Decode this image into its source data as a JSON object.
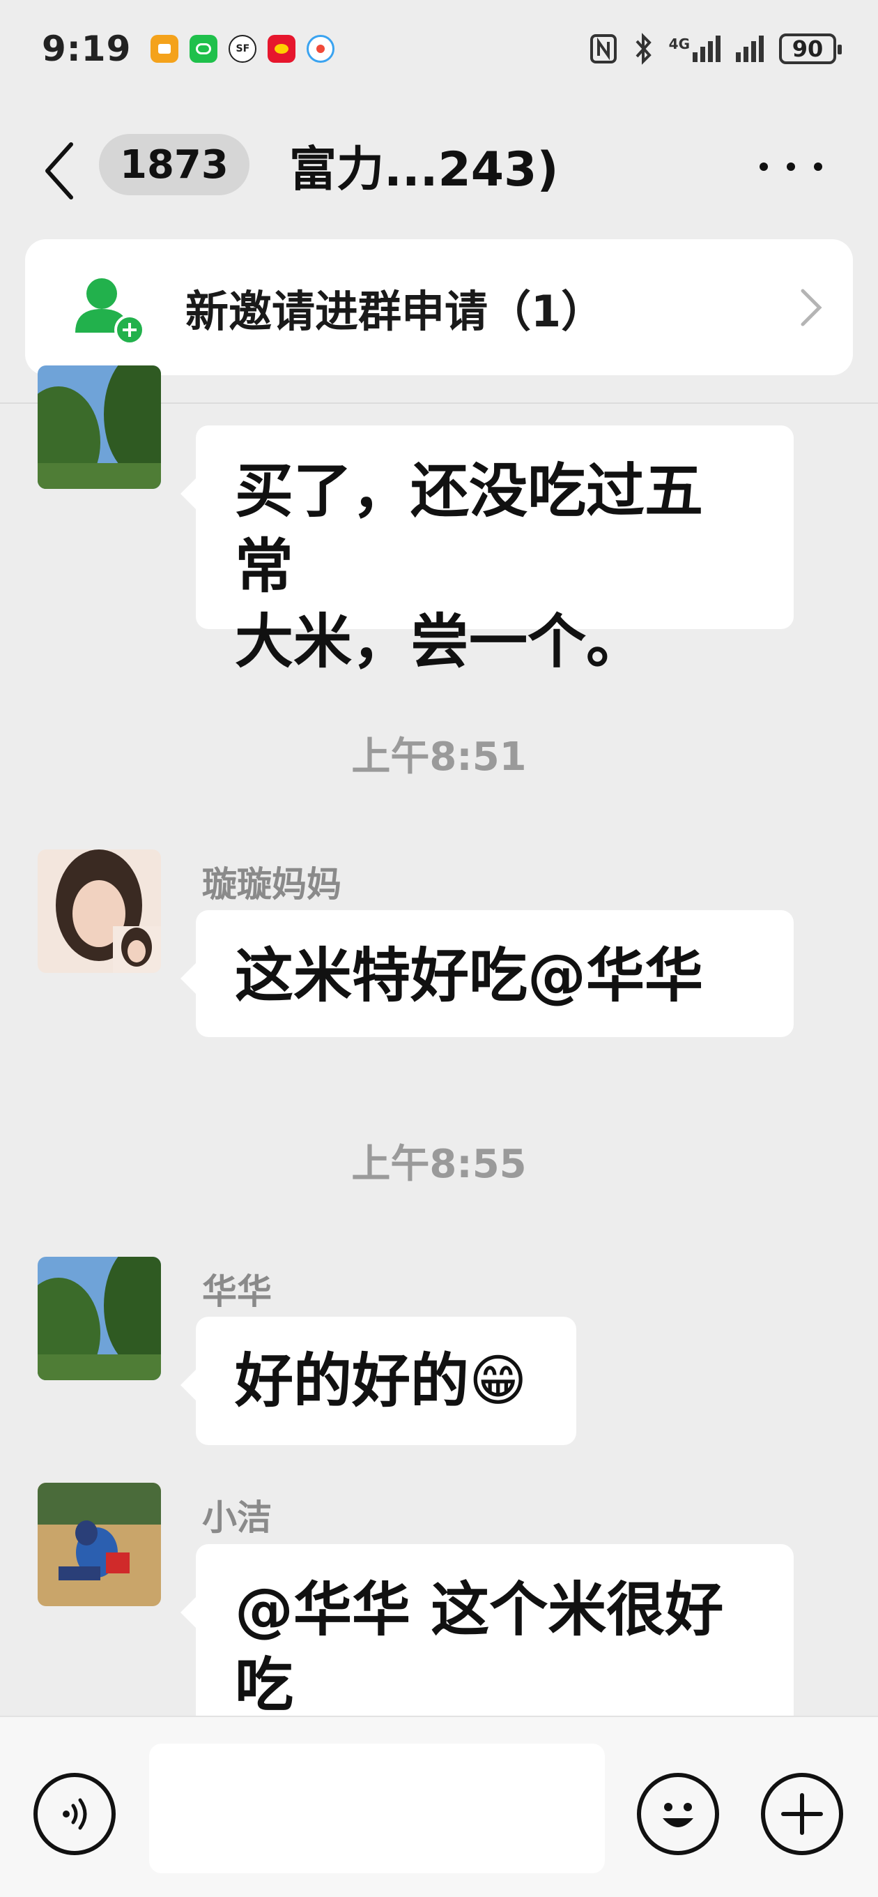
{
  "status_bar": {
    "time": "9:19",
    "battery": "90",
    "network": "4G"
  },
  "header": {
    "unread_count": "1873",
    "title": "富力...243)"
  },
  "invite_banner": {
    "text": "新邀请进群申请（1）"
  },
  "messages": [
    {
      "sender": "",
      "text_line1": "买了，还没吃过五常",
      "text_line2": "大米，尝一个。"
    },
    {
      "timestamp": "上午8:51"
    },
    {
      "sender": "璇璇妈妈",
      "text": "这米特好吃@华华"
    },
    {
      "timestamp": "上午8:55"
    },
    {
      "sender": "华华",
      "text": "好的好的",
      "emoji": "😁"
    },
    {
      "sender": "小洁",
      "text_line1": "@华华  这个米很好",
      "text_line2": "吃"
    }
  ],
  "colors": {
    "background": "#ededed",
    "bubble": "#ffffff",
    "invite_icon": "#22b14c",
    "timestamp": "#9a9a9a"
  }
}
